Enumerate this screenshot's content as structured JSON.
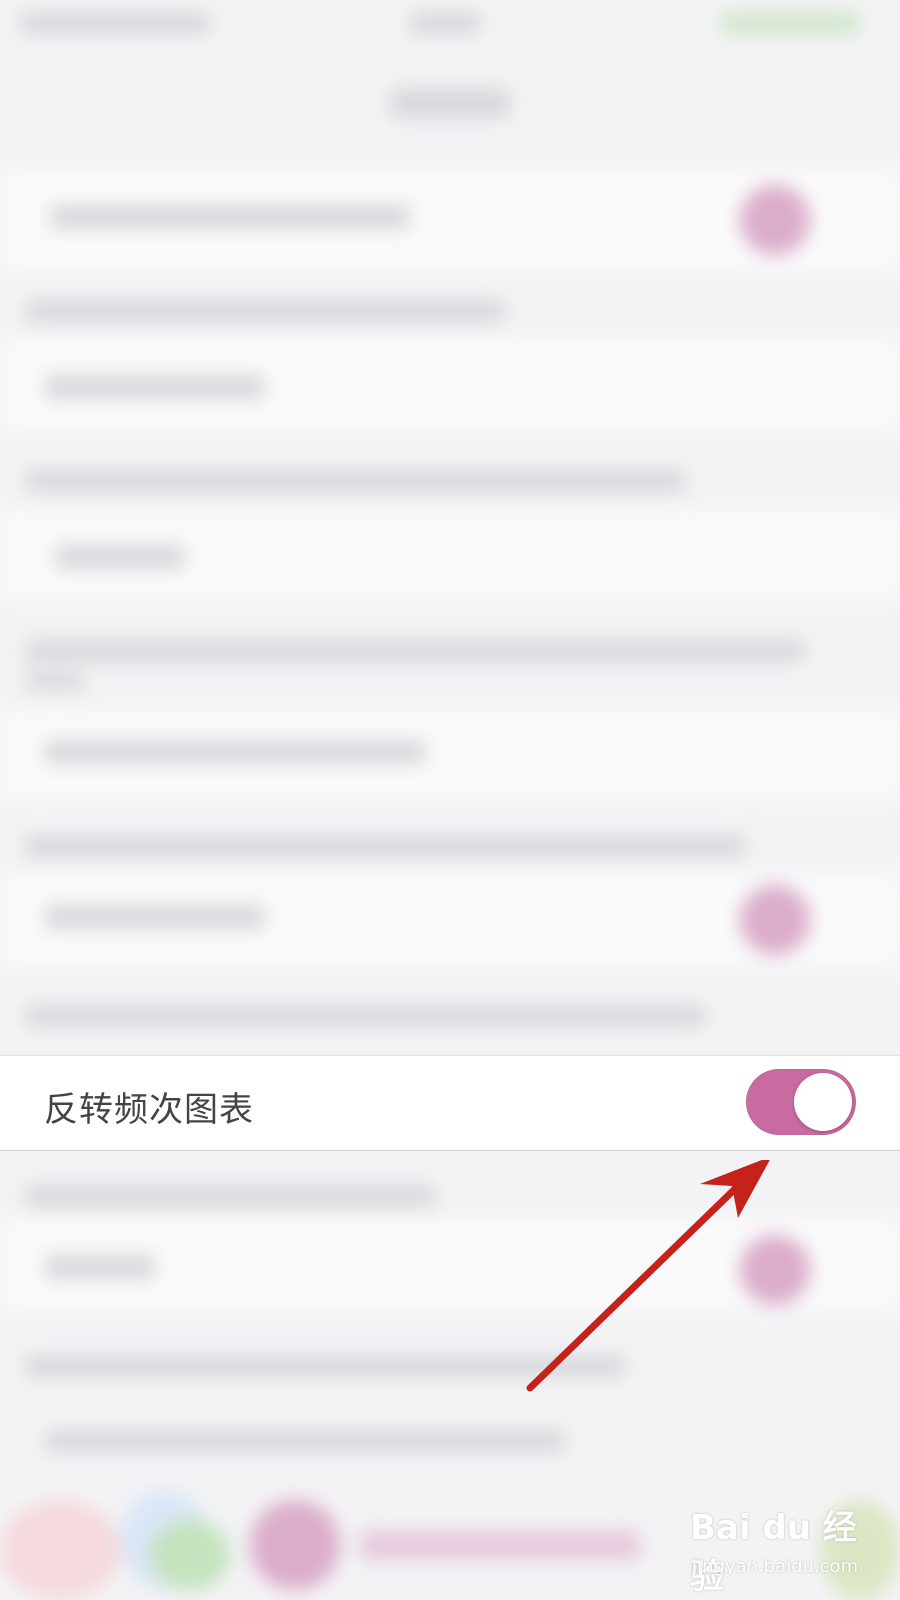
{
  "setting": {
    "label": "反转频次图表",
    "enabled": true
  },
  "colors": {
    "toggle_on": "#c96aa0",
    "arrow": "#c4221a"
  },
  "watermark": {
    "brand": "Bai du 经验",
    "url": "jingyan.baidu.com"
  }
}
